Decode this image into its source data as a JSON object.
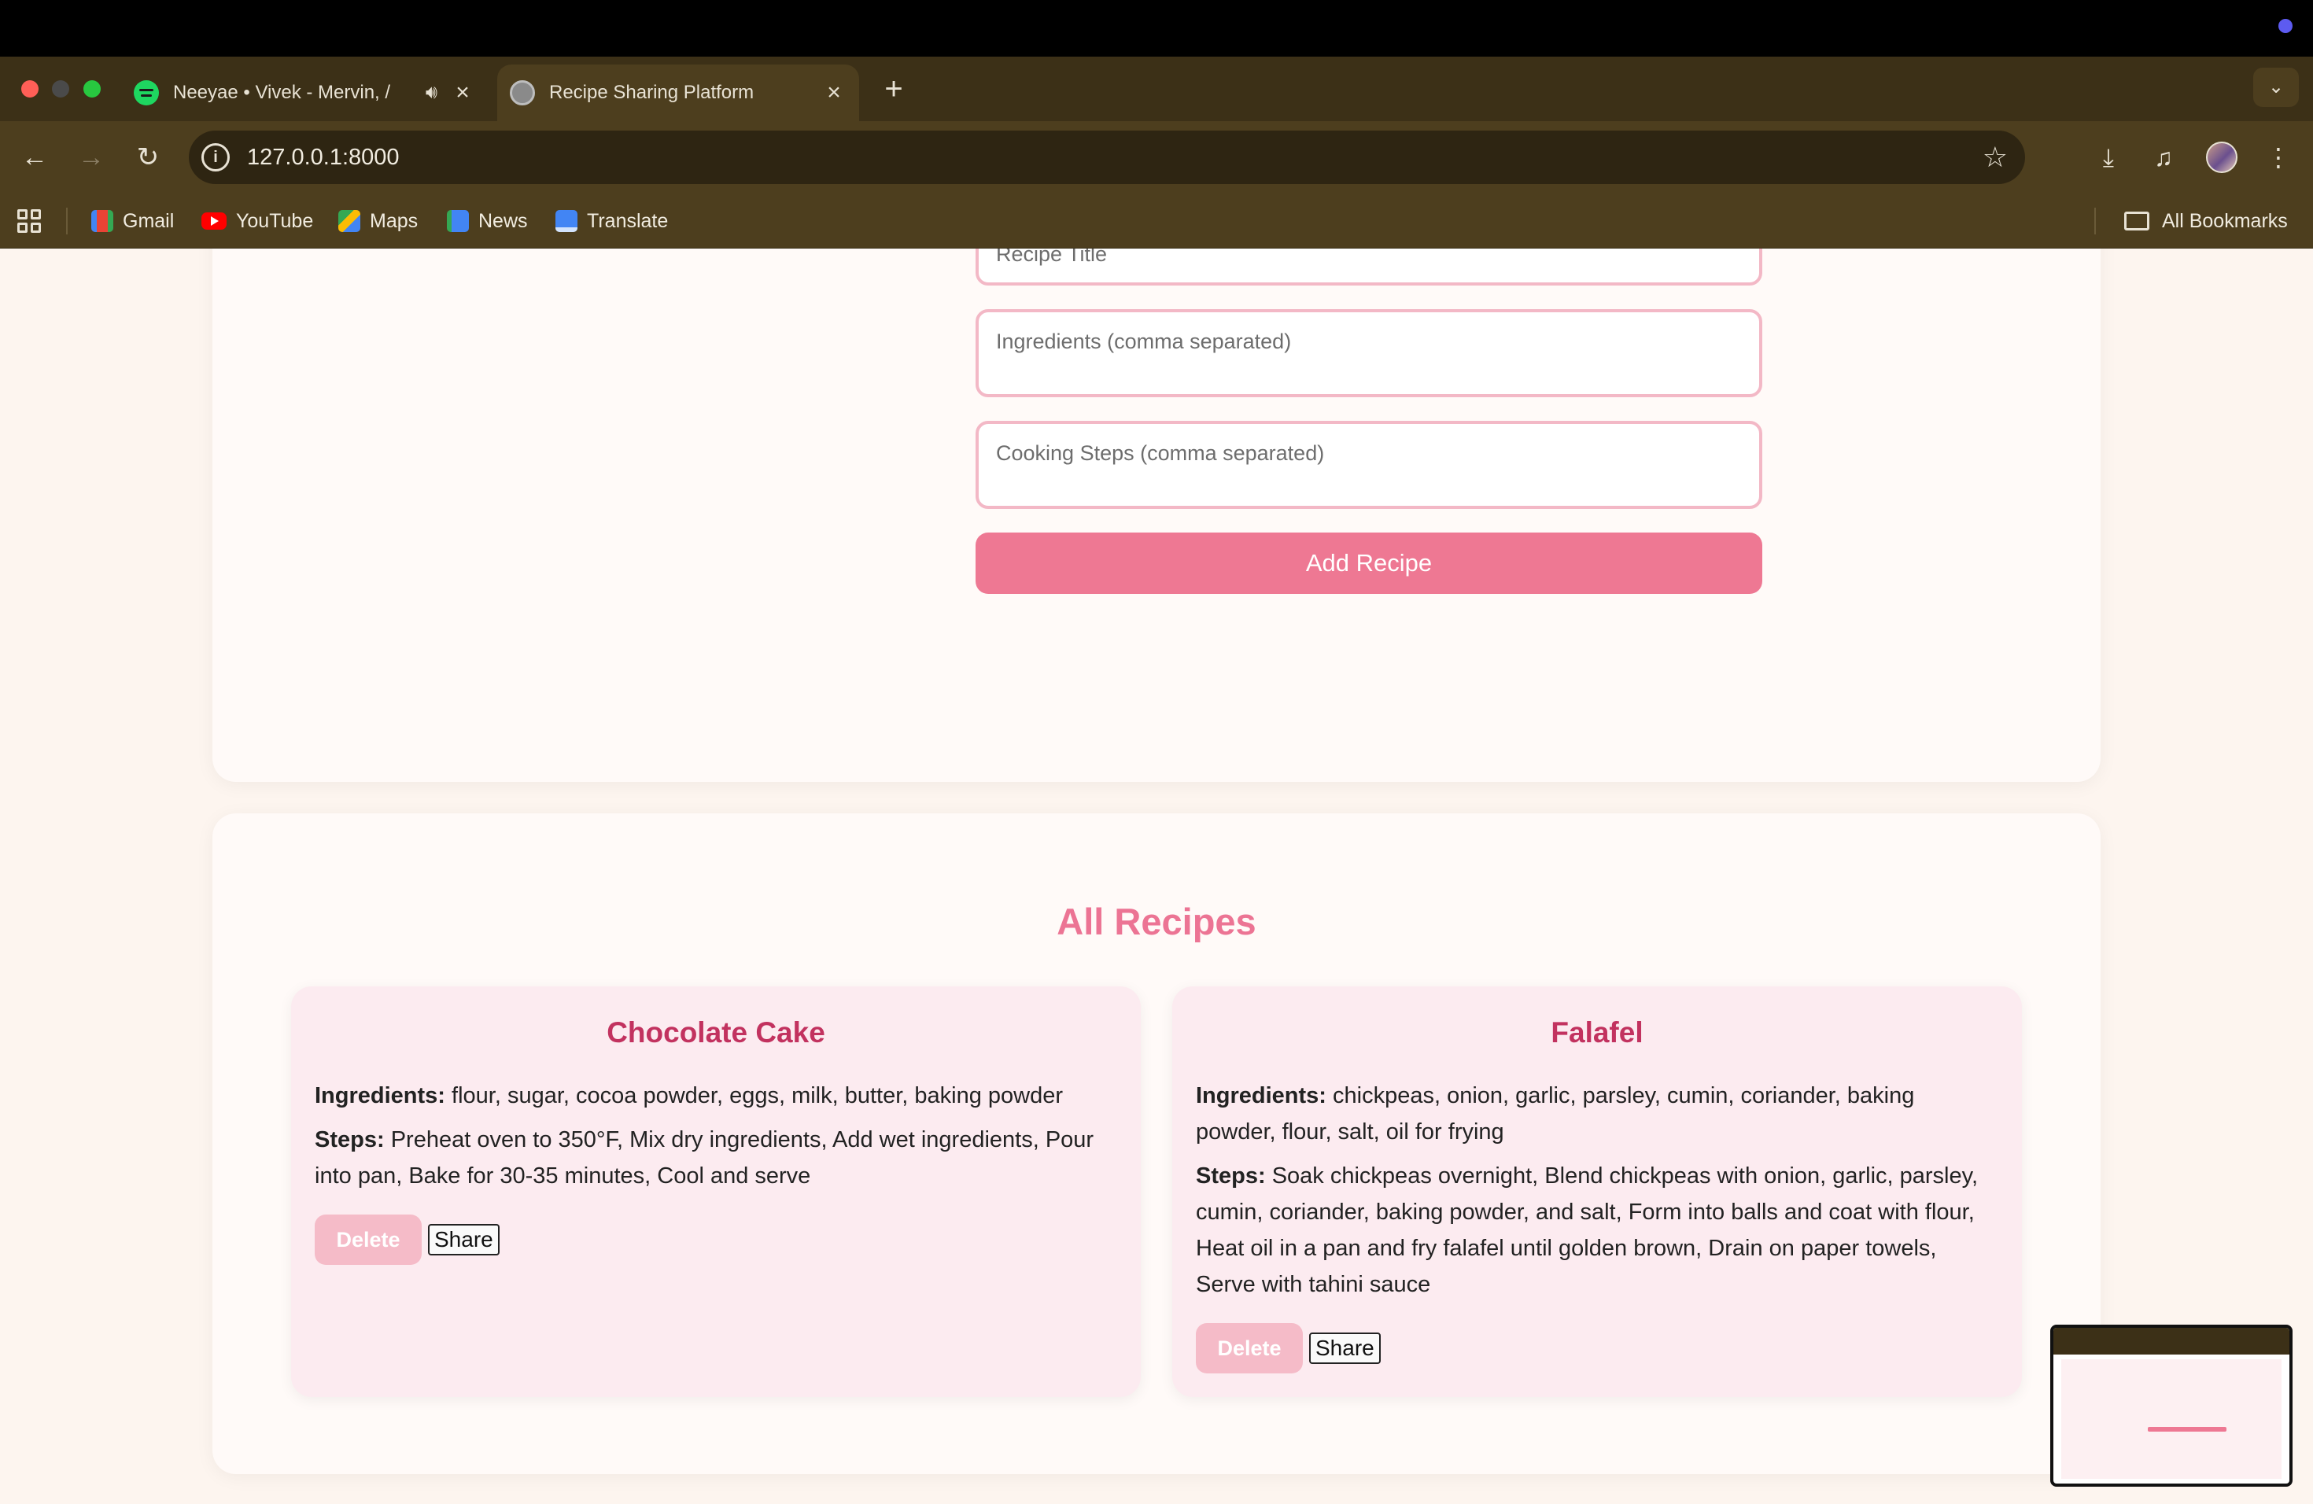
{
  "browser": {
    "tabs": [
      {
        "title": "Neeyae • Vivek - Mervin, /",
        "favicon": "spotify-icon",
        "audio": true,
        "active": false
      },
      {
        "title": "Recipe Sharing Platform",
        "favicon": "globe-icon",
        "active": true
      }
    ],
    "url": "127.0.0.1:8000",
    "bookmarks": [
      {
        "label": "Gmail",
        "icon": "gmail-icon"
      },
      {
        "label": "YouTube",
        "icon": "youtube-icon"
      },
      {
        "label": "Maps",
        "icon": "maps-icon"
      },
      {
        "label": "News",
        "icon": "news-icon"
      },
      {
        "label": "Translate",
        "icon": "translate-icon"
      }
    ],
    "all_bookmarks_label": "All Bookmarks"
  },
  "form": {
    "title_placeholder": "Recipe Title",
    "ingredients_placeholder": "Ingredients (comma separated)",
    "steps_placeholder": "Cooking Steps (comma separated)",
    "submit_label": "Add Recipe"
  },
  "recipes_section": {
    "heading": "All Recipes",
    "ingredients_label": "Ingredients:",
    "steps_label": "Steps:",
    "delete_label": "Delete",
    "share_label": "Share",
    "recipes": [
      {
        "title": "Chocolate Cake",
        "ingredients": "flour, sugar, cocoa powder, eggs, milk, butter, baking powder",
        "steps": "Preheat oven to 350°F, Mix dry ingredients, Add wet ingredients, Pour into pan, Bake for 30-35 minutes, Cool and serve"
      },
      {
        "title": "Falafel",
        "ingredients": "chickpeas, onion, garlic, parsley, cumin, coriander, baking powder, flour, salt, oil for frying",
        "steps": "Soak chickpeas overnight, Blend chickpeas with onion, garlic, parsley, cumin, coriander, baking powder, and salt, Form into balls and coat with flour, Heat oil in a pan and fry falafel until golden brown, Drain on paper towels, Serve with tahini sauce"
      }
    ]
  },
  "colors": {
    "accent": "#ee7893",
    "heading": "#ec7494",
    "recipe_title": "#c2325f",
    "field_border": "#f3b8c6",
    "page_bg": "#fdf5ef"
  }
}
